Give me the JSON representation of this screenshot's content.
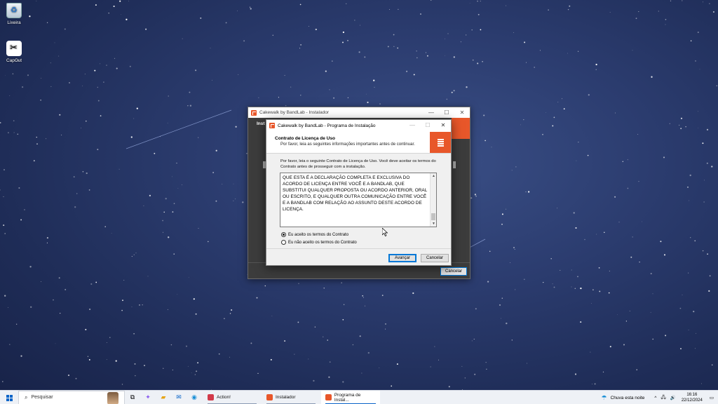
{
  "desktop": {
    "icons": [
      {
        "label": "Lixeira",
        "icon": "recycle-bin-icon"
      },
      {
        "label": "CapCut",
        "icon": "capcut-icon"
      }
    ]
  },
  "background_window": {
    "title": "Cakewalk by BandLab - Instalador",
    "partial_heading": "Inst",
    "cancel_label": "Cancelar"
  },
  "dialog": {
    "title": "Cakewalk by BandLab - Programa de Instalação",
    "header_title": "Contrato de Licença de Uso",
    "header_subtitle": "Por favor, leia as seguintes informações importantes antes de continuar.",
    "intro": "Por favor, leia o seguinte Contrato de Licença de Uso. Você deve aceitar os termos do Contrato antes de prosseguir com a instalação.",
    "license_text": "QUE ESTA É A DECLARAÇÃO COMPLETA E EXCLUSIVA DO ACORDO DE LICENÇA ENTRE VOCÊ E A BANDLAB, QUE SUBSTITUI QUALQUER PROPOSTA OU ACORDO ANTERIOR, ORAL OU ESCRITO, E QUALQUER OUTRA COMUNICAÇÃO ENTRE VOCÊ E A BANDLAB COM RELAÇÃO AO ASSUNTO DESTE ACORDO DE LICENÇA.",
    "accept_label": "Eu aceito os termos do Contrato",
    "decline_label": "Eu não aceito os termos do Contrato",
    "accept_selected": true,
    "next_label": "Avançar",
    "cancel_label": "Cancelar"
  },
  "taskbar": {
    "search_placeholder": "Pesquisar",
    "apps": [
      {
        "label": "Action!",
        "color": "#d23a4a"
      },
      {
        "label": "Instalador",
        "color": "#e8572a"
      },
      {
        "label": "Programa de Instal...",
        "color": "#e8572a",
        "active": true
      }
    ],
    "weather": "Chuva esta noite",
    "time": "16:16",
    "date": "22/12/2024"
  },
  "colors": {
    "accent": "#e8572a",
    "focus": "#0078d7"
  }
}
